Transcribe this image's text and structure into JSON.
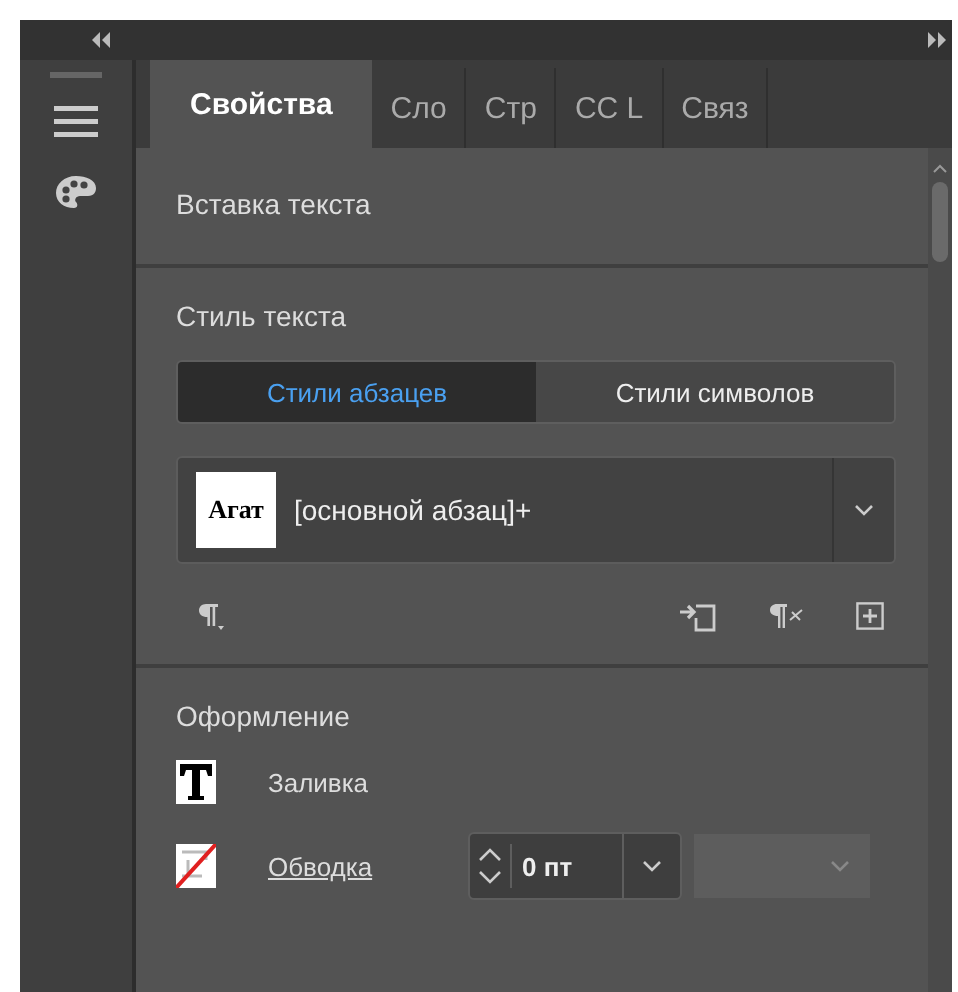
{
  "tabs": [
    {
      "label": "Свойства",
      "selected": true
    },
    {
      "label": "Сло",
      "selected": false
    },
    {
      "label": "Стр",
      "selected": false
    },
    {
      "label": "CC L",
      "selected": false
    },
    {
      "label": "Связ",
      "selected": false
    }
  ],
  "insert_text": {
    "title": "Вставка текста"
  },
  "text_style": {
    "title": "Стиль текста",
    "segments": [
      {
        "label": "Стили абзацев",
        "selected": true
      },
      {
        "label": "Стили символов",
        "selected": false
      }
    ],
    "style_dropdown": {
      "preview": "Агат",
      "value": "[основной абзац]+"
    }
  },
  "appearance": {
    "title": "Оформление",
    "fill": {
      "label": "Заливка"
    },
    "stroke": {
      "label": "Обводка",
      "weight": "0 пт"
    }
  }
}
